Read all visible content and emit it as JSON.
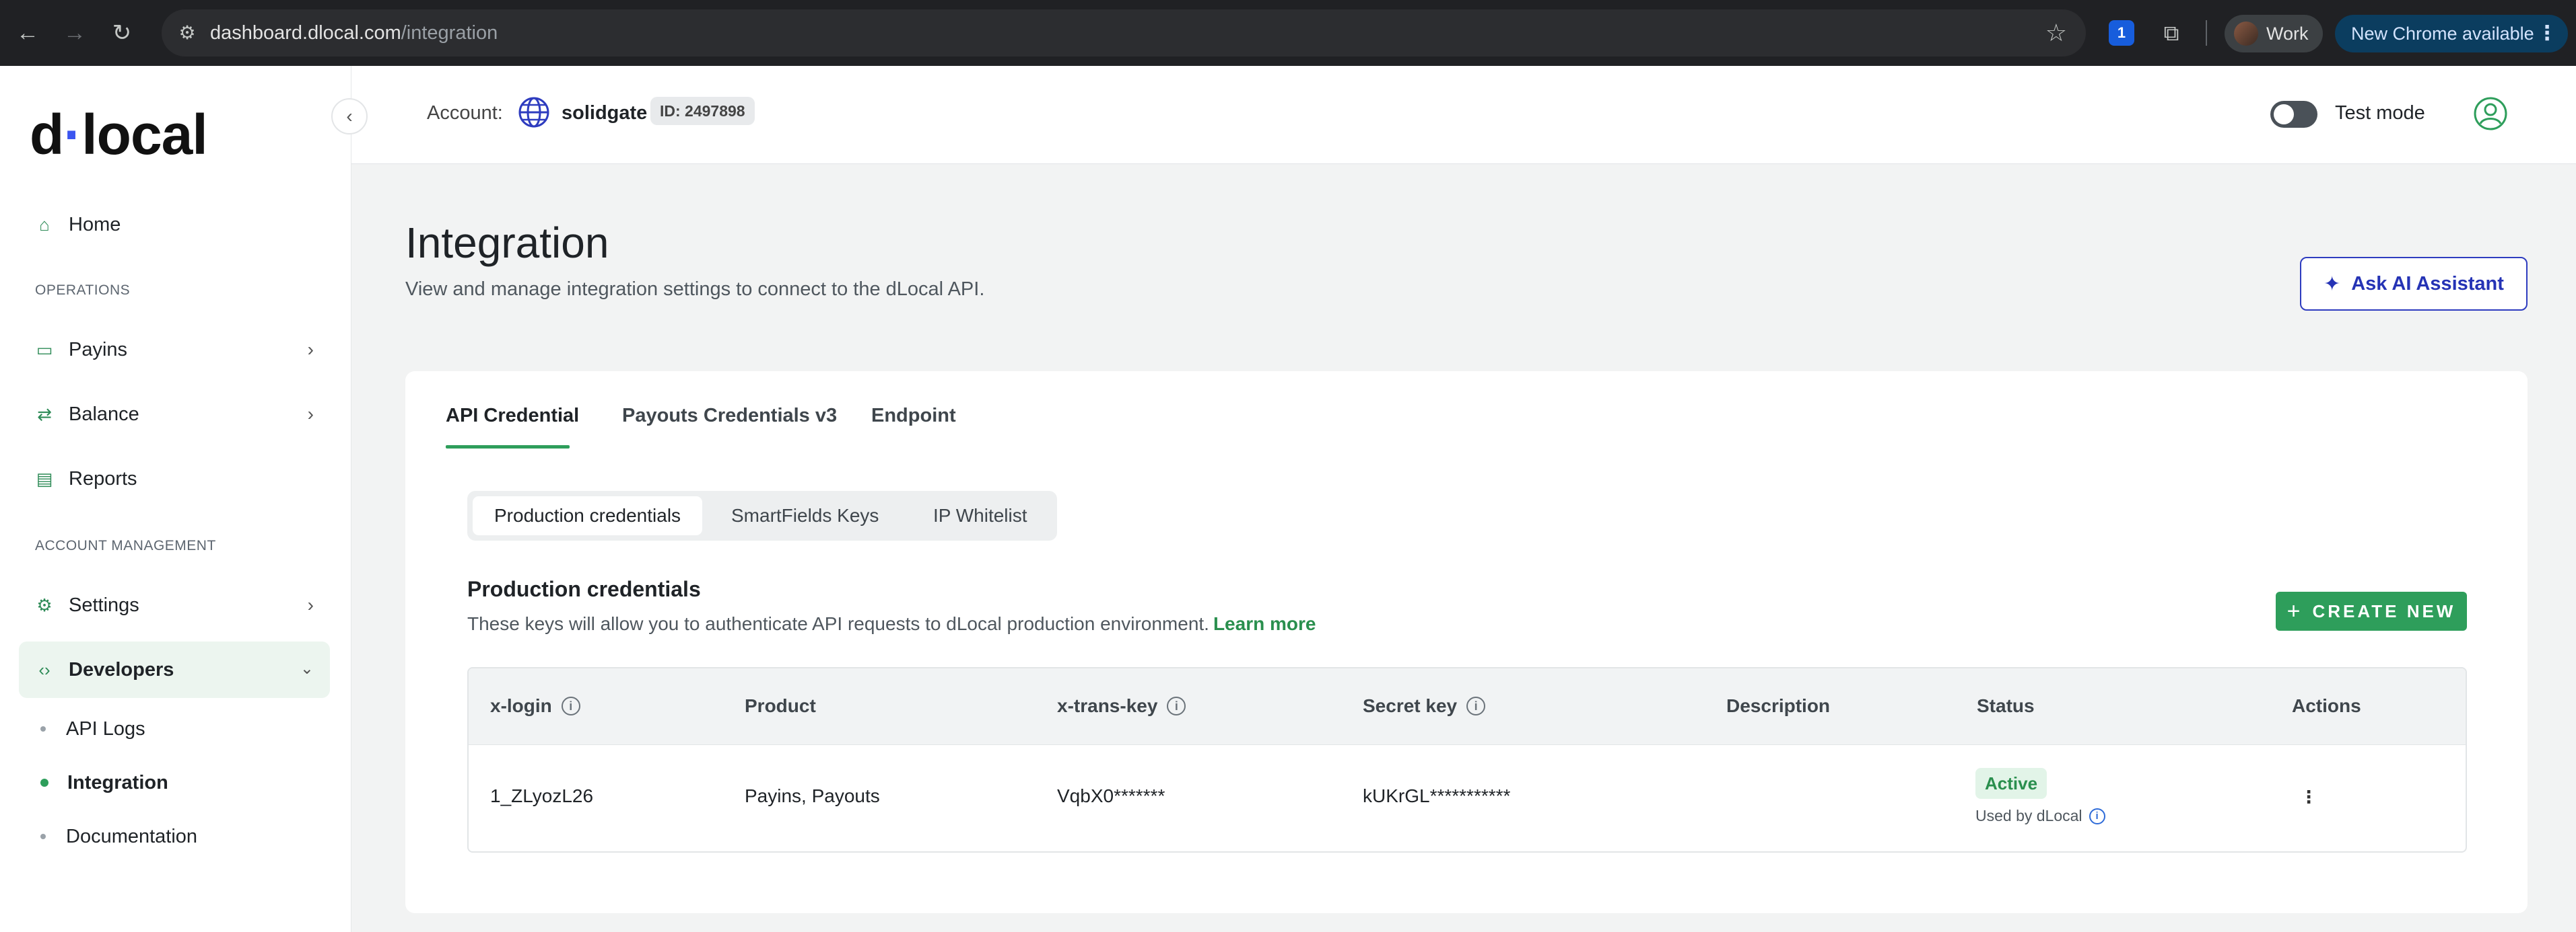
{
  "browser": {
    "url_host": "dashboard.dlocal.com",
    "url_path": "/integration",
    "profile_label": "Work",
    "update_label": "New Chrome available",
    "extension_badge": "1"
  },
  "sidebar": {
    "logo": {
      "left": "d",
      "dot": "·",
      "right": "local"
    },
    "home": "Home",
    "operations_title": "OPERATIONS",
    "payins": "Payins",
    "balance": "Balance",
    "reports": "Reports",
    "account_mgmt_title": "ACCOUNT MANAGEMENT",
    "settings": "Settings",
    "developers": "Developers",
    "sub_items": [
      "API Logs",
      "Integration",
      "Documentation"
    ]
  },
  "topbar": {
    "account_label": "Account:",
    "account_name": "solidgate",
    "account_id": "ID: 2497898",
    "test_mode_label": "Test mode",
    "test_mode_on": false
  },
  "page": {
    "title": "Integration",
    "subtitle": "View and manage integration settings to connect to the dLocal API.",
    "ai_button": "Ask AI Assistant"
  },
  "tabs": [
    "API Credential",
    "Payouts Credentials v3",
    "Endpoint"
  ],
  "active_tab": "API Credential",
  "segments": [
    "Production credentials",
    "SmartFields Keys",
    "IP Whitelist"
  ],
  "active_segment": "Production credentials",
  "section": {
    "title": "Production credentials",
    "description": "These keys will allow you to authenticate API requests to dLocal production environment.",
    "learn_more": "Learn more",
    "create_button": "CREATE NEW"
  },
  "table": {
    "headers": [
      "x-login",
      "Product",
      "x-trans-key",
      "Secret key",
      "Description",
      "Status",
      "Actions"
    ],
    "rows": [
      {
        "x_login": "1_ZLyozL26",
        "product": "Payins, Payouts",
        "x_trans_key": "VqbX0*******",
        "secret_key": "kUKrGL***********",
        "description": "",
        "status": "Active",
        "status_note": "Used by dLocal",
        "actions": "⋮"
      }
    ]
  },
  "colors": {
    "accent_green": "#2e9e5b",
    "ai_blue": "#2533b5",
    "logo_dot": "#3b55f0"
  }
}
